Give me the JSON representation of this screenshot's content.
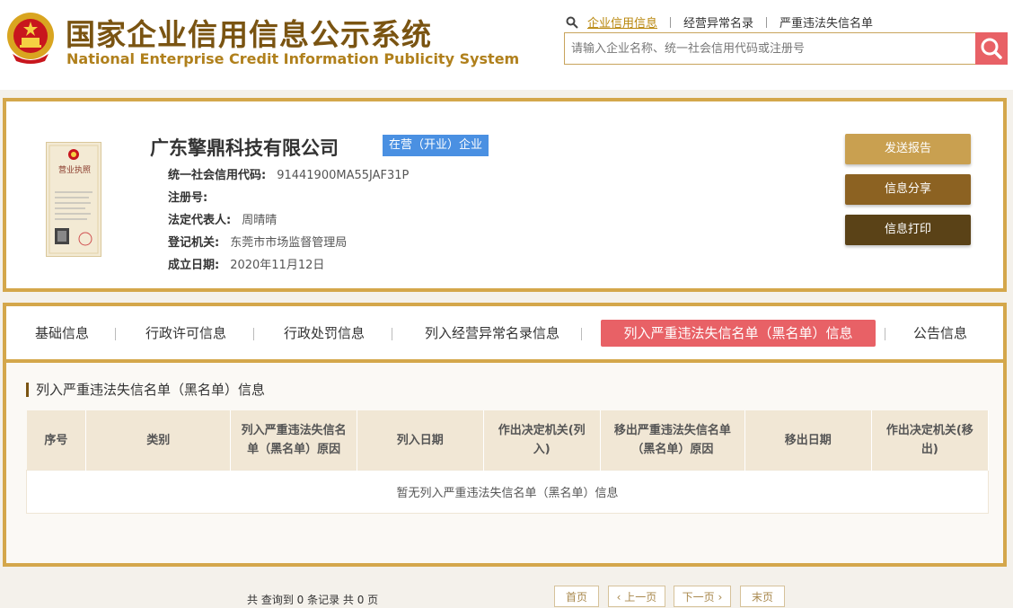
{
  "header": {
    "title_cn": "国家企业信用信息公示系统",
    "title_en": "National Enterprise Credit Information Publicity System",
    "nav": [
      "企业信用信息",
      "经营异常名录",
      "严重违法失信名单"
    ],
    "search_placeholder": "请输入企业名称、统一社会信用代码或注册号"
  },
  "company": {
    "name": "广东擎鼎科技有限公司",
    "status": "在营（开业）企业",
    "license_title": "营业执照",
    "fields": [
      {
        "label": "统一社会信用代码:",
        "value": "91441900MA55JAF31P"
      },
      {
        "label": "注册号:",
        "value": ""
      },
      {
        "label": "法定代表人:",
        "value": "周晴晴"
      },
      {
        "label": "登记机关:",
        "value": "东莞市市场监督管理局"
      },
      {
        "label": "成立日期:",
        "value": "2020年11月12日"
      }
    ],
    "actions": [
      "发送报告",
      "信息分享",
      "信息打印"
    ]
  },
  "tabs": [
    "基础信息",
    "行政许可信息",
    "行政处罚信息",
    "列入经营异常名录信息",
    "列入严重违法失信名单（黑名单）信息",
    "公告信息"
  ],
  "active_tab": 4,
  "section": {
    "title": "列入严重违法失信名单（黑名单）信息",
    "columns": [
      "序号",
      "类别",
      "列入严重违法失信名单（黑名单）原因",
      "列入日期",
      "作出决定机关(列入)",
      "移出严重违法失信名单（黑名单）原因",
      "移出日期",
      "作出决定机关(移出)"
    ],
    "empty_text": "暂无列入严重违法失信名单（黑名单）信息"
  },
  "pagination": {
    "summary": "共 查询到 0 条记录 共 0 页",
    "first": "首页",
    "prev": "上一页",
    "next": "下一页",
    "last": "末页"
  },
  "colors": {
    "gold": "#d4a74b",
    "brown": "#7a5412",
    "accent_red": "#e86166",
    "status_blue": "#4a90e2"
  }
}
